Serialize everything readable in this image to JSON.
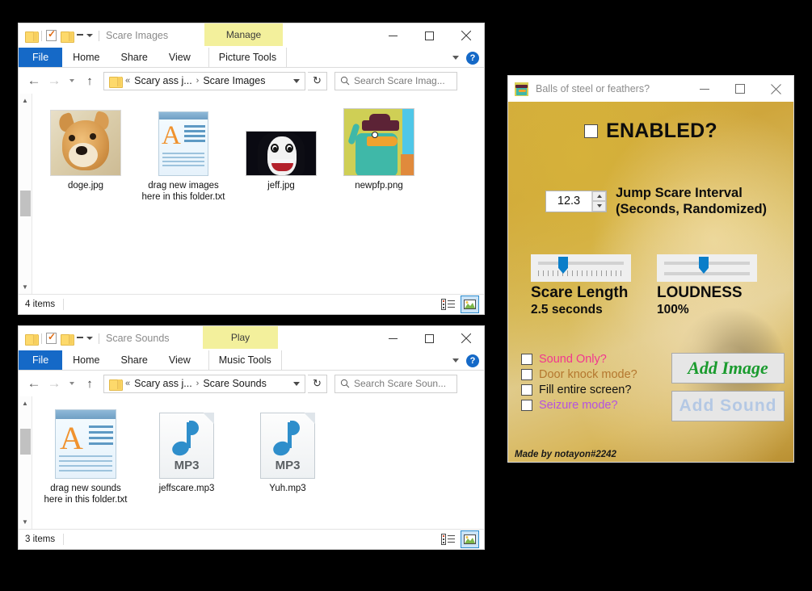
{
  "explorer_images": {
    "window_title": "Scare Images",
    "contextual_tab": "Manage",
    "quick_access": [
      "folder-icon",
      "properties-icon",
      "new-folder-icon",
      "customize-caret-icon"
    ],
    "window_buttons": {
      "minimize": "minimize-icon",
      "maximize": "maximize-icon",
      "close": "close-icon"
    },
    "ribbon_tabs": [
      {
        "label": "File"
      },
      {
        "label": "Home"
      },
      {
        "label": "Share"
      },
      {
        "label": "View"
      },
      {
        "label": "Picture Tools"
      }
    ],
    "nav": {
      "back": "←",
      "forward": "→",
      "recent_caret": "chevron-down-icon",
      "up": "↑"
    },
    "address": {
      "root": "«",
      "crumb1": "Scary ass j...",
      "sep": "›",
      "crumb2": "Scare Images"
    },
    "refresh": "↻",
    "search": {
      "placeholder": "Search Scare Imag...",
      "icon": "search-icon"
    },
    "files": [
      {
        "name": "doge.jpg",
        "kind": "image-doge"
      },
      {
        "name": "drag new images here in this folder.txt",
        "kind": "text-file"
      },
      {
        "name": "jeff.jpg",
        "kind": "image-jeff"
      },
      {
        "name": "newpfp.png",
        "kind": "image-perry"
      }
    ],
    "status": "4 items",
    "view_buttons": [
      {
        "name": "details-view",
        "selected": false
      },
      {
        "name": "large-icons-view",
        "selected": true
      }
    ]
  },
  "explorer_sounds": {
    "window_title": "Scare Sounds",
    "contextual_tab": "Play",
    "ribbon_tabs": [
      {
        "label": "File"
      },
      {
        "label": "Home"
      },
      {
        "label": "Share"
      },
      {
        "label": "View"
      },
      {
        "label": "Music Tools"
      }
    ],
    "address": {
      "root": "«",
      "crumb1": "Scary ass j...",
      "sep": "›",
      "crumb2": "Scare Sounds"
    },
    "search": {
      "placeholder": "Search Scare Soun...",
      "icon": "search-icon"
    },
    "files": [
      {
        "name": "drag new sounds here in this folder.txt",
        "kind": "text-file"
      },
      {
        "name": "jeffscare.mp3",
        "kind": "mp3-file",
        "badge": "MP3"
      },
      {
        "name": "Yuh.mp3",
        "kind": "mp3-file",
        "badge": "MP3"
      }
    ],
    "status": "3 items"
  },
  "scare_app": {
    "title": "Balls of steel or feathers?",
    "icon": "perry-platypus-icon",
    "window_buttons": {
      "minimize": "minimize-icon",
      "maximize": "maximize-icon",
      "close": "close-icon"
    },
    "enabled": {
      "label": "ENABLED?",
      "checked": false
    },
    "interval": {
      "value": "12.3",
      "label_line1": "Jump Scare Interval",
      "label_line2": "(Seconds, Randomized)"
    },
    "sliders": [
      {
        "name": "scare-length",
        "title": "Scare Length",
        "sub": "2.5 seconds",
        "percent": 30,
        "ticks": true
      },
      {
        "name": "loudness",
        "title": "LOUDNESS",
        "sub": "100%",
        "percent": 47,
        "ticks": false
      }
    ],
    "checkboxes": [
      {
        "label": "Sound Only?",
        "color": "#f2368f",
        "checked": false
      },
      {
        "label": "Door knock mode?",
        "color": "#b4772e",
        "checked": false
      },
      {
        "label": "Fill entire screen?",
        "color": "#101010",
        "checked": false
      },
      {
        "label": "Seizure mode?",
        "color": "#b452e0",
        "checked": false
      }
    ],
    "buttons": [
      {
        "name": "add-image",
        "label": "Add Image",
        "color": "#1a9b2e"
      },
      {
        "name": "add-sound",
        "label": "Add  Sound",
        "color": "#b4c8e4"
      }
    ],
    "credit": "Made by notayon#2242"
  }
}
